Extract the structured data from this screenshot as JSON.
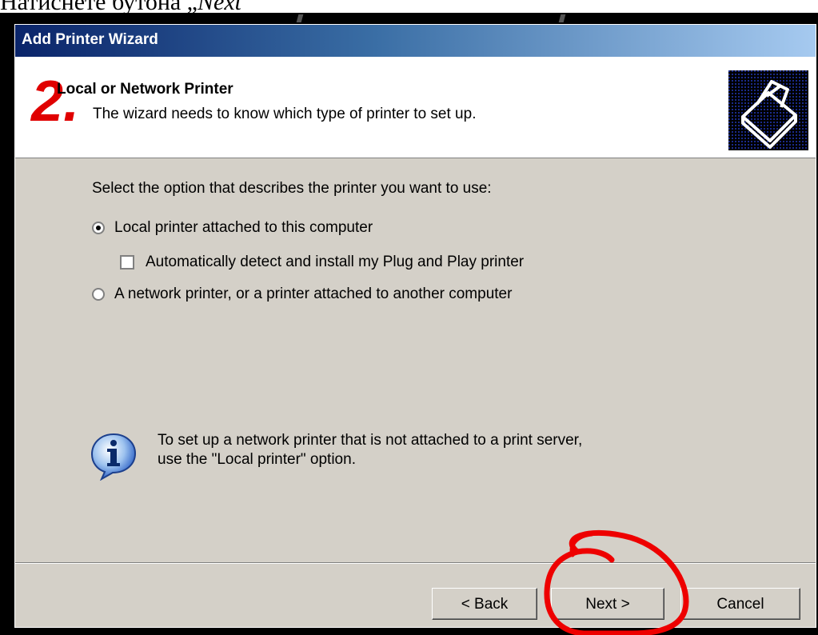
{
  "caption": {
    "prefix": "Натиснете бутона „",
    "em": "Next"
  },
  "window": {
    "title": "Add Printer Wizard"
  },
  "header": {
    "step_marker": "2.",
    "title": "Local or Network Printer",
    "subtitle": "The wizard needs to know which type of printer to set up."
  },
  "body": {
    "prompt": "Select the option that describes the printer you want to use:",
    "options": [
      {
        "label": "Local printer attached to this computer",
        "selected": true
      },
      {
        "label": "A network printer, or a printer attached to another computer",
        "selected": false
      }
    ],
    "checkbox": {
      "label": "Automatically detect and install my Plug and Play printer",
      "checked": false
    },
    "info": {
      "line1": "To set up a network printer that is not attached to a print server,",
      "line2": "use the \"Local printer\" option."
    }
  },
  "buttons": {
    "back": "< Back",
    "next": "Next >",
    "cancel": "Cancel"
  },
  "colors": {
    "annotation": "#ee0000",
    "title_gradient_start": "#0a246a",
    "title_gradient_end": "#a6caf0",
    "dialog_face": "#d4d0c8"
  },
  "icons": {
    "printer": "printer-icon",
    "info": "info-icon"
  }
}
